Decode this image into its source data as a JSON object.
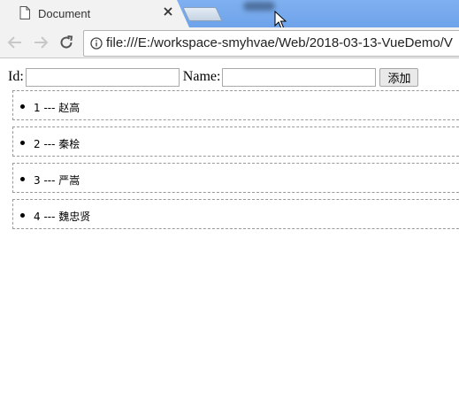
{
  "browser": {
    "tab_title": "Document",
    "url": "file:///E:/workspace-smyhvae/Web/2018-03-13-VueDemo/V"
  },
  "form": {
    "id_label": "Id:",
    "id_value": "",
    "name_label": "Name:",
    "name_value": "",
    "add_button": "添加"
  },
  "list": {
    "items": [
      {
        "text": "1 --- 赵高"
      },
      {
        "text": "2 --- 秦桧"
      },
      {
        "text": "3 --- 严嵩"
      },
      {
        "text": "4 --- 魏忠贤"
      }
    ]
  }
}
